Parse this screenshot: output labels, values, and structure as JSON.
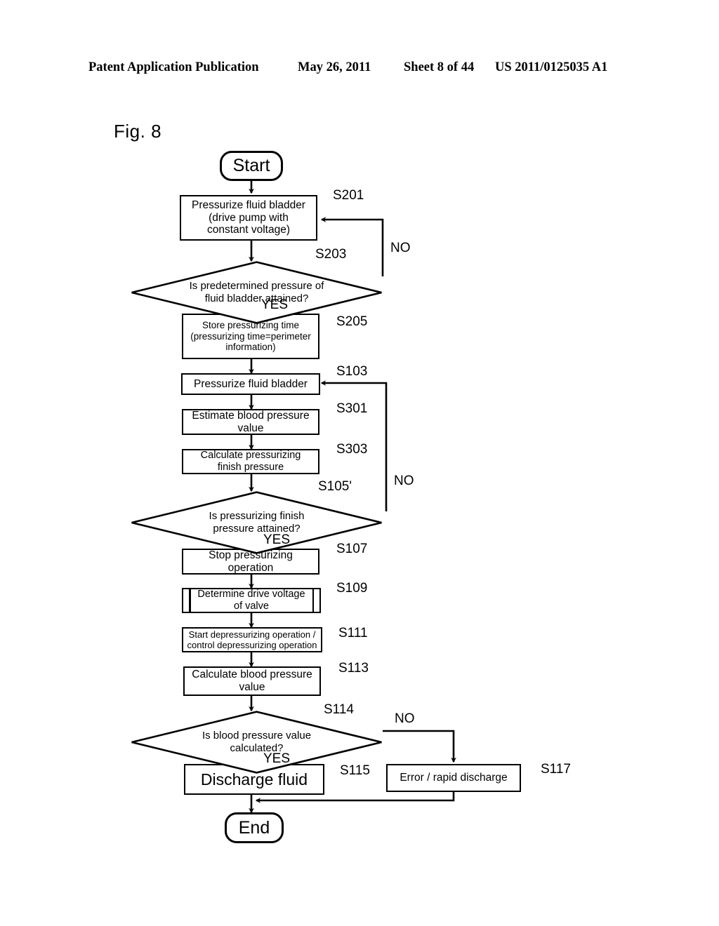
{
  "header": {
    "publication": "Patent Application Publication",
    "date": "May 26, 2011",
    "sheet": "Sheet 8 of 44",
    "number": "US 2011/0125035 A1"
  },
  "figure": {
    "label": "Fig. 8"
  },
  "flowchart": {
    "start_label": "Start",
    "end_label": "End",
    "nodes": [
      {
        "id": "S201",
        "ref": "S201",
        "type": "process",
        "text": "Pressurize fluid bladder\n(drive pump with\nconstant voltage)"
      },
      {
        "id": "S203",
        "ref": "S203",
        "type": "decision",
        "text": "Is predetermined pressure of\nfluid bladder attained?"
      },
      {
        "id": "S205",
        "ref": "S205",
        "type": "process",
        "text": "Store pressurizing time\n(pressurizing time=perimeter\ninformation)"
      },
      {
        "id": "S103",
        "ref": "S103",
        "type": "process",
        "text": "Pressurize fluid bladder"
      },
      {
        "id": "S301",
        "ref": "S301",
        "type": "process",
        "text": "Estimate blood pressure\nvalue"
      },
      {
        "id": "S303",
        "ref": "S303",
        "type": "process",
        "text": "Calculate pressurizing\nfinish pressure"
      },
      {
        "id": "S105",
        "ref": "S105'",
        "type": "decision",
        "text": "Is pressurizing finish\npressure attained?"
      },
      {
        "id": "S107",
        "ref": "S107",
        "type": "process",
        "text": "Stop pressurizing\noperation"
      },
      {
        "id": "S109",
        "ref": "S109",
        "type": "predefined",
        "text": "Determine drive voltage\nof valve"
      },
      {
        "id": "S111",
        "ref": "S111",
        "type": "process",
        "text": "Start depressurizing operation /\ncontrol depressurizing operation"
      },
      {
        "id": "S113",
        "ref": "S113",
        "type": "process",
        "text": "Calculate blood pressure\nvalue"
      },
      {
        "id": "S114",
        "ref": "S114",
        "type": "decision",
        "text": "Is blood pressure value\ncalculated?"
      },
      {
        "id": "S115",
        "ref": "S115",
        "type": "process",
        "text": "Discharge fluid"
      },
      {
        "id": "S117",
        "ref": "S117",
        "type": "process",
        "text": "Error / rapid discharge"
      }
    ],
    "branch_labels": {
      "no_s203": "NO",
      "yes_s203": "YES",
      "no_s105": "NO",
      "yes_s105": "YES",
      "no_s114": "NO",
      "yes_s114": "YES"
    }
  },
  "colors": {
    "ink": "#000000",
    "paper": "#ffffff"
  }
}
